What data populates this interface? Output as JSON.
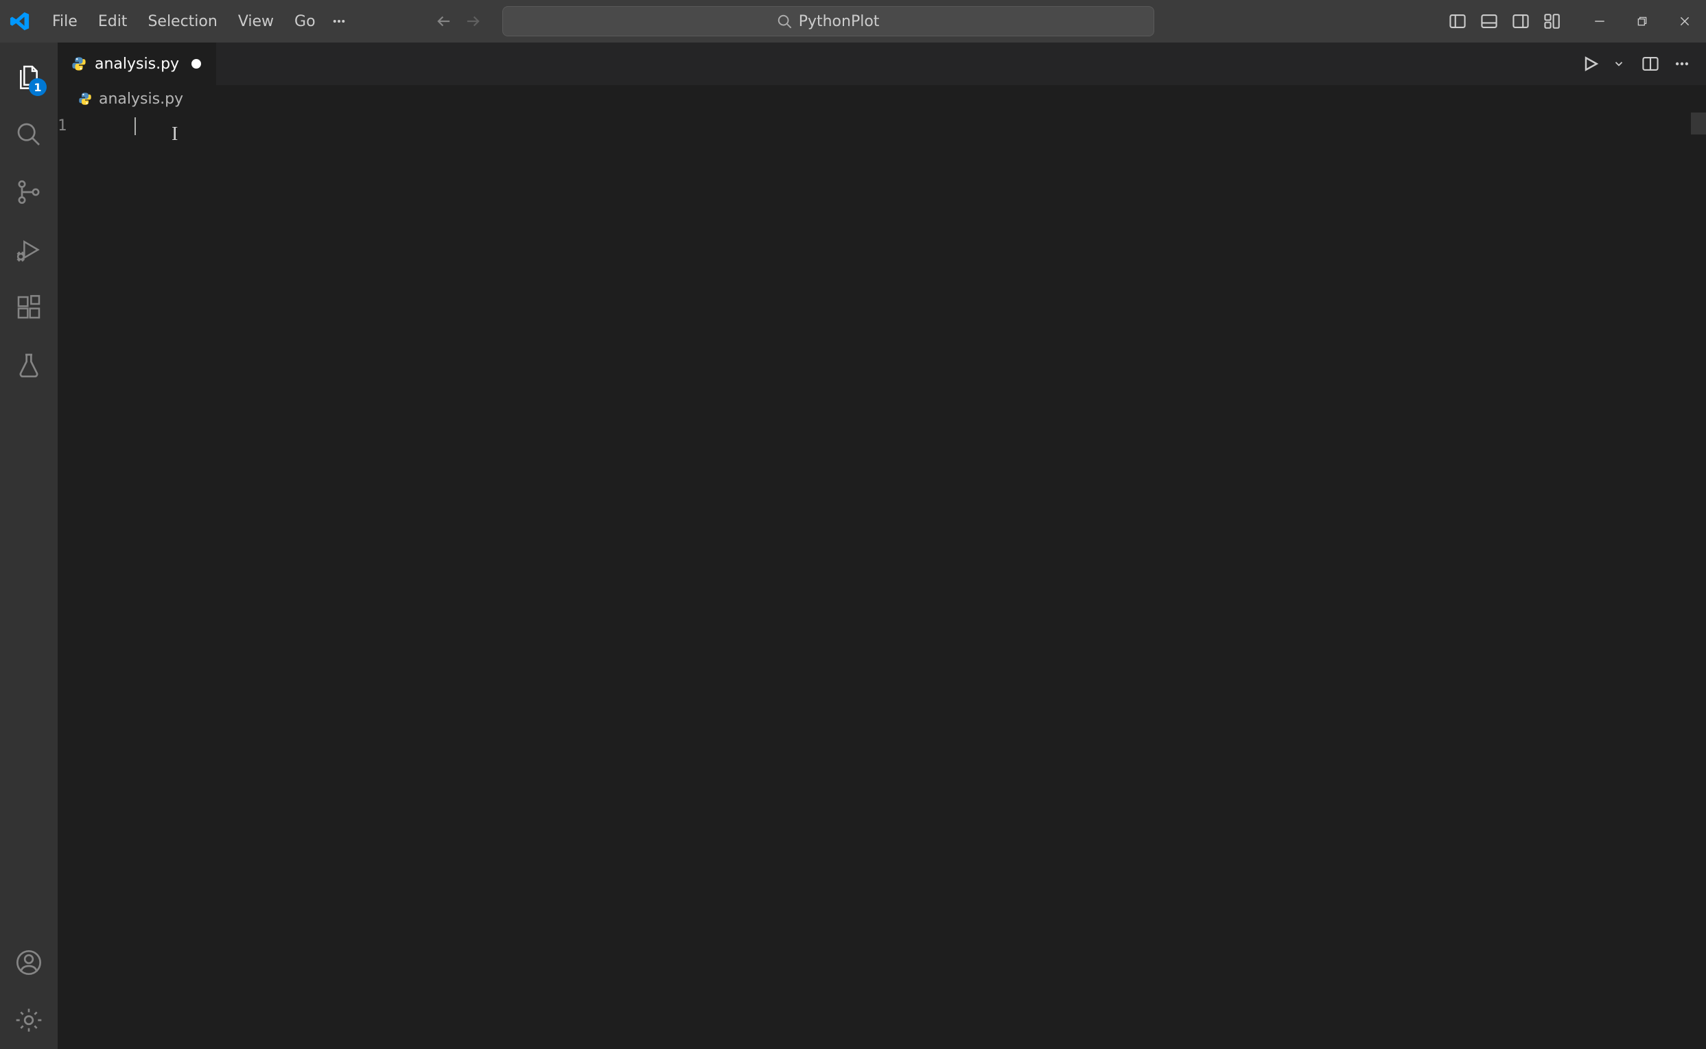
{
  "titlebar": {
    "menus": [
      "File",
      "Edit",
      "Selection",
      "View",
      "Go"
    ],
    "search_text": "PythonPlot"
  },
  "activitybar": {
    "explorer_badge": "1"
  },
  "tabs": {
    "active": {
      "label": "analysis.py",
      "dirty": true
    }
  },
  "breadcrumb": {
    "label": "analysis.py"
  },
  "editor": {
    "line_numbers": [
      "1"
    ],
    "lines": [
      ""
    ]
  }
}
